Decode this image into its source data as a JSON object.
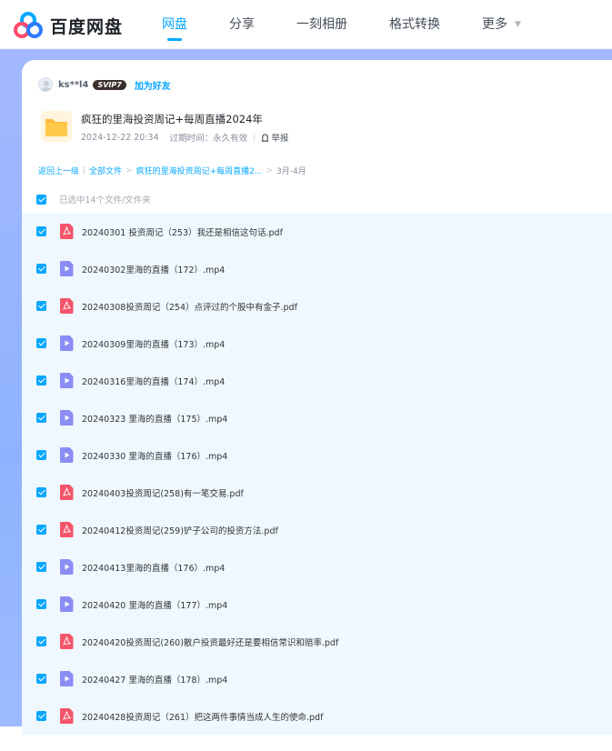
{
  "header": {
    "logo_text": "百度网盘",
    "nav": [
      {
        "label": "网盘",
        "active": true
      },
      {
        "label": "分享",
        "active": false
      },
      {
        "label": "一刻相册",
        "active": false
      },
      {
        "label": "格式转换",
        "active": false
      },
      {
        "label": "更多",
        "active": false
      }
    ]
  },
  "share": {
    "user_name": "ks**l4",
    "badge": "SVIP7",
    "add_friend": "加为好友",
    "title": "疯狂的里海投资周记+每周直播2024年",
    "date": "2024-12-22 20:34",
    "expiry": "过期时间：永久有效",
    "report": "举报"
  },
  "breadcrumb": {
    "back": "返回上一级",
    "all": "全部文件",
    "folder": "疯狂的里海投资周记+每周直播2...",
    "current": "3月-4月"
  },
  "selection": {
    "label": "已选中14个文件/文件夹"
  },
  "files": [
    {
      "name": "20240301 投资周记（253）我还是相信这句话.pdf",
      "type": "pdf"
    },
    {
      "name": "20240302里海的直播（172）.mp4",
      "type": "video"
    },
    {
      "name": "20240308投资周记（254）点评过的个股中有金子.pdf",
      "type": "pdf"
    },
    {
      "name": "20240309里海的直播（173）.mp4",
      "type": "video"
    },
    {
      "name": "20240316里海的直播（174）.mp4",
      "type": "video"
    },
    {
      "name": "20240323 里海的直播（175）.mp4",
      "type": "video"
    },
    {
      "name": "20240330 里海的直播（176）.mp4",
      "type": "video"
    },
    {
      "name": "20240403投资周记(258)有一笔交易.pdf",
      "type": "pdf"
    },
    {
      "name": "20240412投资周记(259)铲子公司的投资方法.pdf",
      "type": "pdf"
    },
    {
      "name": "20240413里海的直播（176）.mp4",
      "type": "video"
    },
    {
      "name": "20240420 里海的直播（177）.mp4",
      "type": "video"
    },
    {
      "name": "20240420投资周记(260)散户投资最好还是要相信常识和赔率.pdf",
      "type": "pdf"
    },
    {
      "name": "20240427 里海的直播（178）.mp4",
      "type": "video"
    },
    {
      "name": "20240428投资周记（261）把这两件事情当成人生的使命.pdf",
      "type": "pdf"
    }
  ],
  "colors": {
    "accent": "#06a7ff",
    "pdf": "#f4556a",
    "video": "#8c8cf5",
    "folder": "#ffc94a",
    "row_bg": "#eff8ff"
  },
  "icons": {
    "pdf": "pdf-file-icon",
    "video": "video-file-icon",
    "folder": "folder-icon"
  }
}
